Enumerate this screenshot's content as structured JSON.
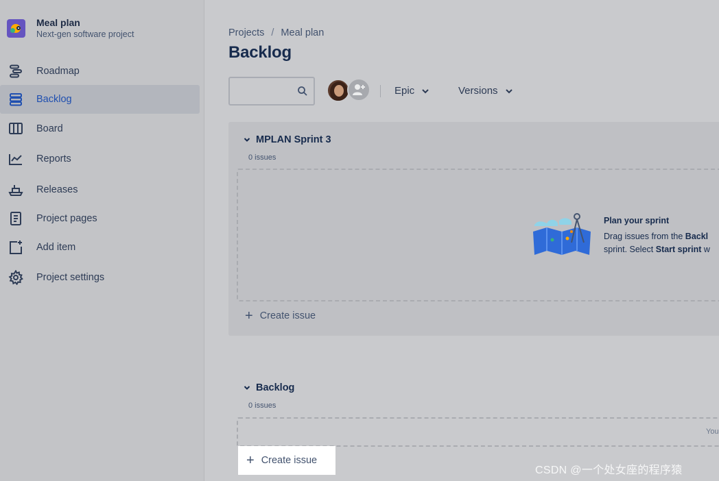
{
  "project": {
    "name": "Meal plan",
    "subtitle": "Next-gen software project"
  },
  "nav": [
    {
      "label": "Roadmap",
      "icon": "roadmap-icon",
      "active": false
    },
    {
      "label": "Backlog",
      "icon": "backlog-icon",
      "active": true
    },
    {
      "label": "Board",
      "icon": "board-icon",
      "active": false
    },
    {
      "label": "Reports",
      "icon": "reports-icon",
      "active": false
    },
    {
      "label": "Releases",
      "icon": "releases-icon",
      "active": false
    },
    {
      "label": "Project pages",
      "icon": "project-pages-icon",
      "active": false
    },
    {
      "label": "Add item",
      "icon": "add-item-icon",
      "active": false
    },
    {
      "label": "Project settings",
      "icon": "gear-icon",
      "active": false
    }
  ],
  "breadcrumb": {
    "projects": "Projects",
    "separator": "/",
    "current": "Meal plan"
  },
  "page_title": "Backlog",
  "search": {
    "value": "",
    "placeholder": ""
  },
  "filters": {
    "epic": "Epic",
    "versions": "Versions"
  },
  "sprint": {
    "name": "MPLAN Sprint 3",
    "count": "0 issues",
    "plan_title": "Plan your sprint",
    "plan_desc_1a": "Drag issues from the ",
    "plan_desc_1b": "Backl",
    "plan_desc_2a": "sprint. Select ",
    "plan_desc_2b": "Start sprint",
    "plan_desc_2c": " w",
    "create_label": "Create issue"
  },
  "backlog": {
    "name": "Backlog",
    "count": "0 issues",
    "empty_text": "You",
    "create_label": "Create issue"
  },
  "watermark": "CSDN @一个处女座的程序猿",
  "colors": {
    "accent": "#1f4fb0",
    "active_bg": "#b3b6bd",
    "panel": "#bfc0c4"
  }
}
